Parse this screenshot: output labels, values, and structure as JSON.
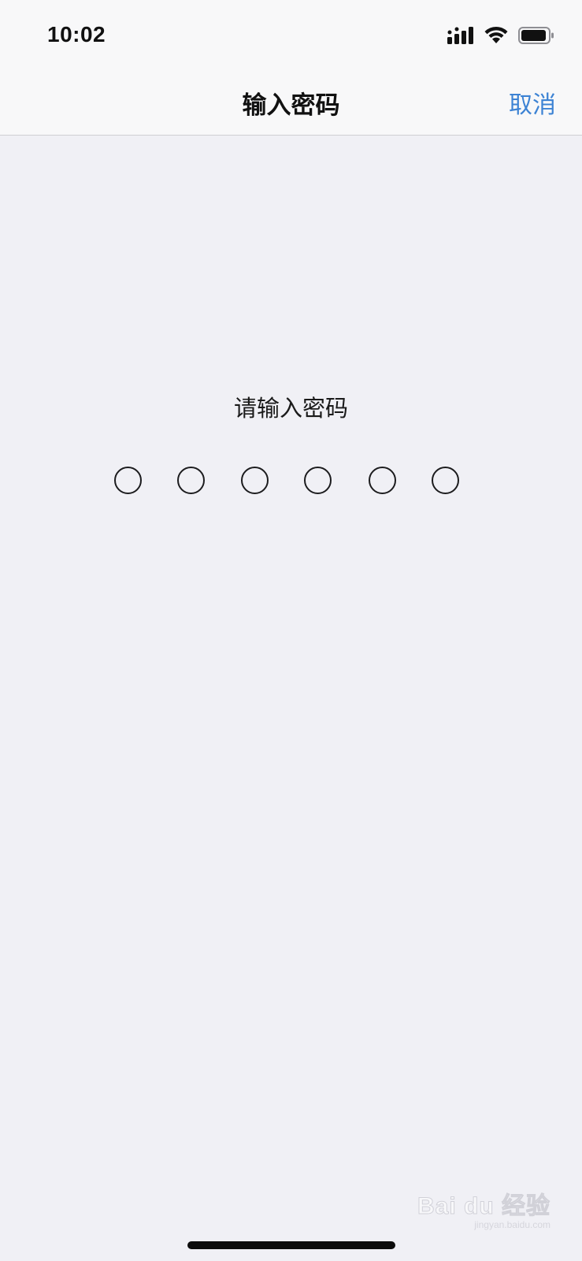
{
  "status_bar": {
    "time": "10:02",
    "icons": [
      "signal-icon",
      "wifi-icon",
      "battery-icon"
    ]
  },
  "nav": {
    "title": "输入密码",
    "cancel_label": "取消"
  },
  "passcode": {
    "prompt": "请输入密码",
    "digits_total": 6,
    "digits_entered": 0
  },
  "watermark": {
    "main": "Bai du 经验",
    "sub": "jingyan.baidu.com"
  },
  "colors": {
    "accent": "#3d83d4",
    "background": "#f0f0f5",
    "nav_background": "#f8f8f9"
  }
}
